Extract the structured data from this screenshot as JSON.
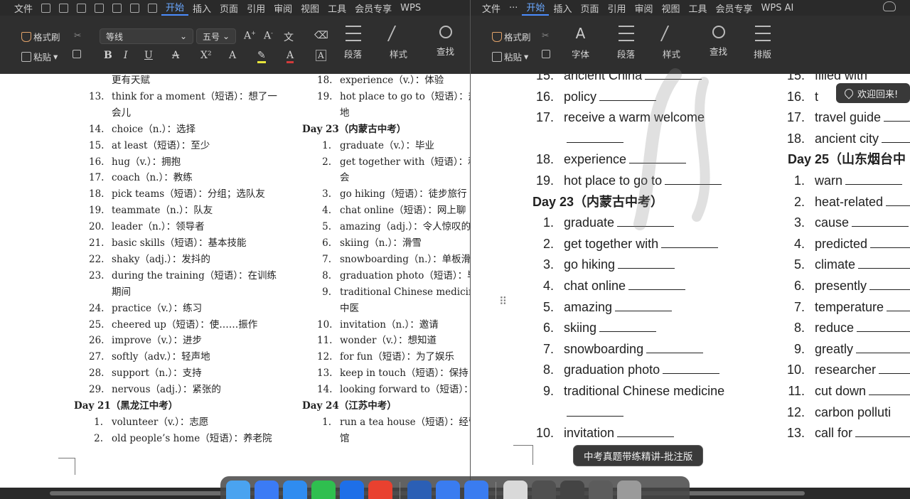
{
  "left_window": {
    "menu": [
      "文件",
      "开始",
      "插入",
      "页面",
      "引用",
      "审阅",
      "视图",
      "工具",
      "会员专享",
      "WPS"
    ],
    "active_tab": "开始",
    "ribbon": {
      "format_painter": "格式刷",
      "paste": "粘贴",
      "font_name": "等线",
      "font_size": "五号",
      "paragraph": "段落",
      "style": "样式",
      "find": "查找"
    },
    "col1": [
      {
        "n": "",
        "t": "更有天赋"
      },
      {
        "n": "13.",
        "t": "think for a moment（短语）：想了一"
      },
      {
        "n": "",
        "t": "会儿"
      },
      {
        "n": "14.",
        "t": "choice（n.）：选择"
      },
      {
        "n": "15.",
        "t": "at least（短语）：至少"
      },
      {
        "n": "16.",
        "t": "hug（v.）：拥抱"
      },
      {
        "n": "17.",
        "t": "coach（n.）：教练"
      },
      {
        "n": "18.",
        "t": "pick teams（短语）：分组；选队友"
      },
      {
        "n": "19.",
        "t": "teammate（n.）：队友"
      },
      {
        "n": "20.",
        "t": "leader（n.）：领导者"
      },
      {
        "n": "21.",
        "t": "basic skills（短语）：基本技能"
      },
      {
        "n": "22.",
        "t": "shaky（adj.）：发抖的"
      },
      {
        "n": "23.",
        "t": "during the training（短语）：在训练"
      },
      {
        "n": "",
        "t": "期间"
      },
      {
        "n": "24.",
        "t": "practice（v.）：练习"
      },
      {
        "n": "25.",
        "t": "cheered up（短语）：使……振作"
      },
      {
        "n": "26.",
        "t": "improve（v.）：进步"
      },
      {
        "n": "27.",
        "t": "softly（adv.）：轻声地"
      },
      {
        "n": "28.",
        "t": "support（n.）：支持"
      },
      {
        "n": "29.",
        "t": "nervous（adj.）：紧张的"
      },
      {
        "h": "Day 21（黑龙江中考）"
      },
      {
        "n": "1.",
        "t": "volunteer（v.）：志愿"
      },
      {
        "n": "2.",
        "t": "old people’s home（短语）：养老院"
      }
    ],
    "col2": [
      {
        "n": "18.",
        "t": "experience（v.）：体验"
      },
      {
        "n": "19.",
        "t": "hot place to go to（短语）：热"
      },
      {
        "n": "",
        "t": "地"
      },
      {
        "h": "Day 23（内蒙古中考）"
      },
      {
        "n": "1.",
        "t": "graduate（v.）：毕业"
      },
      {
        "n": "2.",
        "t": "get together with（短语）：和"
      },
      {
        "n": "",
        "t": "会"
      },
      {
        "n": "3.",
        "t": "go hiking（短语）：徒步旅行"
      },
      {
        "n": "4.",
        "t": "chat online（短语）：网上聊"
      },
      {
        "n": "5.",
        "t": "amazing（adj.）：令人惊叹的"
      },
      {
        "n": "6.",
        "t": "skiing（n.）：滑雪"
      },
      {
        "n": "7.",
        "t": "snowboarding（n.）：单板滑"
      },
      {
        "n": "8.",
        "t": "graduation photo（短语）：毕"
      },
      {
        "n": "9.",
        "t": "traditional Chinese medicine"
      },
      {
        "n": "",
        "t": "中医"
      },
      {
        "n": "10.",
        "t": "invitation（n.）：邀请"
      },
      {
        "n": "11.",
        "t": "wonder（v.）：想知道"
      },
      {
        "n": "12.",
        "t": "for fun（短语）：为了娱乐"
      },
      {
        "n": "13.",
        "t": "keep in touch（短语）：保持"
      },
      {
        "n": "14.",
        "t": "looking forward to（短语）："
      },
      {
        "h": "Day 24（江苏中考）"
      },
      {
        "n": "1.",
        "t": "run a tea house（短语）：经营"
      },
      {
        "n": "",
        "t": "馆"
      }
    ]
  },
  "right_window": {
    "menu": [
      "文件",
      "···",
      "开始",
      "插入",
      "页面",
      "引用",
      "审阅",
      "视图",
      "工具",
      "会员专享",
      "WPS AI"
    ],
    "active_tab": "开始",
    "ribbon": {
      "format_painter": "格式刷",
      "paste": "粘贴",
      "font": "字体",
      "paragraph": "段落",
      "style": "样式",
      "find": "查找",
      "layout": "排版"
    },
    "col1": [
      {
        "n": "15.",
        "t": "ancient China",
        "blank": true
      },
      {
        "n": "16.",
        "t": "policy",
        "blank": true
      },
      {
        "n": "17.",
        "t": "receive a warm welcome",
        "blank": false
      },
      {
        "n": "",
        "t": "",
        "blank": true
      },
      {
        "n": "18.",
        "t": "experience",
        "blank": true
      },
      {
        "n": "19.",
        "t": "hot place to go to",
        "blank": true
      },
      {
        "h": "Day 23（内蒙古中考）"
      },
      {
        "n": "1.",
        "t": "graduate",
        "blank": true
      },
      {
        "n": "2.",
        "t": "get together with",
        "blank": true
      },
      {
        "n": "3.",
        "t": "go hiking",
        "blank": true
      },
      {
        "n": "4.",
        "t": "chat online",
        "blank": true
      },
      {
        "n": "5.",
        "t": "amazing",
        "blank": true
      },
      {
        "n": "6.",
        "t": "skiing",
        "blank": true
      },
      {
        "n": "7.",
        "t": "snowboarding",
        "blank": true
      },
      {
        "n": "8.",
        "t": "graduation photo",
        "blank": true
      },
      {
        "n": "9.",
        "t": "traditional Chinese medicine",
        "blank": false
      },
      {
        "n": "",
        "t": "",
        "blank": true
      },
      {
        "n": "10.",
        "t": "invitation",
        "blank": true
      }
    ],
    "col2": [
      {
        "n": "15.",
        "t": "filled with",
        "blank": false
      },
      {
        "n": "16.",
        "t": "t",
        "blank": false
      },
      {
        "n": "17.",
        "t": "travel guide",
        "blank": true
      },
      {
        "n": "18.",
        "t": "ancient city",
        "blank": true
      },
      {
        "h": "Day 25（山东烟台中"
      },
      {
        "n": "1.",
        "t": "warn",
        "blank": true
      },
      {
        "n": "2.",
        "t": "heat-related",
        "blank": true
      },
      {
        "n": "3.",
        "t": "cause",
        "blank": true
      },
      {
        "n": "4.",
        "t": "predicted",
        "blank": true
      },
      {
        "n": "5.",
        "t": "climate",
        "blank": true
      },
      {
        "n": "6.",
        "t": "presently",
        "blank": true
      },
      {
        "n": "7.",
        "t": "temperature",
        "blank": true
      },
      {
        "n": "8.",
        "t": "reduce",
        "blank": true
      },
      {
        "n": "9.",
        "t": "greatly",
        "blank": true
      },
      {
        "n": "10.",
        "t": "researcher",
        "blank": true
      },
      {
        "n": "11.",
        "t": "cut down",
        "blank": true
      },
      {
        "n": "12.",
        "t": "carbon polluti",
        "blank": false
      },
      {
        "n": "13.",
        "t": "call for",
        "blank": true
      }
    ]
  },
  "toast": {
    "text": "欢迎回来!"
  },
  "tooltip": {
    "text": "中考真题带练精讲-批注版"
  },
  "dock": {
    "apps": [
      {
        "icon": "finder-icon",
        "color": "#4aa3f0"
      },
      {
        "icon": "feishu-icon",
        "color": "#3b7bf5"
      },
      {
        "icon": "safari-icon",
        "color": "#2f8cf0"
      },
      {
        "icon": "wechat-icon",
        "color": "#2fbf4f"
      },
      {
        "icon": "lark-icon",
        "color": "#1e6fe8"
      },
      {
        "icon": "wps-icon",
        "color": "#e9412f"
      },
      {
        "sep": true
      },
      {
        "icon": "word-icon",
        "color": "#2b5fb5"
      },
      {
        "icon": "wps-doc-icon",
        "color": "#3a7cf0"
      },
      {
        "icon": "wps-doc-icon-2",
        "color": "#3a7cf0"
      },
      {
        "sep": true
      },
      {
        "icon": "preview-icon",
        "color": "#d9d9d9"
      },
      {
        "icon": "window-thumb-1",
        "color": "#505050"
      },
      {
        "icon": "window-thumb-2",
        "color": "#444444"
      },
      {
        "icon": "window-thumb-3",
        "color": "#5c5c5c"
      },
      {
        "icon": "trash-icon",
        "color": "#9a9a9a"
      }
    ]
  },
  "colors": {
    "accent": "#4b8dff",
    "ribbon_bg": "#2f2f2f",
    "page_bg": "#ffffff"
  }
}
